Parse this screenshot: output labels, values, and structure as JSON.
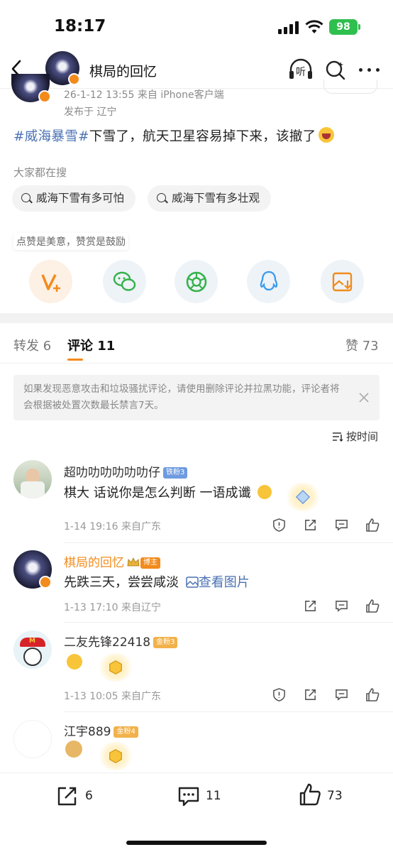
{
  "status_bar": {
    "time": "18:17",
    "battery": "98"
  },
  "nav": {
    "title": "棋局的回忆",
    "listen_label": "听"
  },
  "post": {
    "date_source": "26-1-12 13:55  来自 iPhone客户端",
    "location": "发布于 辽宁",
    "hashtag": "#威海暴雪#",
    "text": "下雪了，航天卫星容易掉下来，该撤了"
  },
  "search_section": {
    "title": "大家都在搜",
    "chips": [
      "威海下雪有多可怕",
      "威海下雪有多壮观"
    ]
  },
  "share_tip": "点赞是美意，赞赏是鼓励",
  "tabs": {
    "repost": "转发 6",
    "comment": "评论 11",
    "like": "赞 73"
  },
  "notice": "如果发现恶意攻击和垃圾骚扰评论，请使用删除评论并拉黑功能，评论者将会根据被处置次数最长禁言7天。",
  "sort_label": "按时间",
  "comments": [
    {
      "name": "超叻叻叻叻叻叻仔",
      "badge": "铁粉3",
      "text": "棋大 话说你是怎么判断 一语成谶",
      "meta": "1-14 19:16  来自广东"
    },
    {
      "name": "棋局的回忆",
      "badge": "博主",
      "text": "先跌三天，尝尝咸淡",
      "link": "查看图片",
      "meta": "1-13 17:10  来自辽宁"
    },
    {
      "name": "二友先锋22418",
      "badge": "金粉3",
      "text": "",
      "meta": "1-13 10:05  来自广东"
    },
    {
      "name": "江宇889",
      "badge": "金粉4",
      "text": "",
      "meta": ""
    }
  ],
  "bottom_bar": {
    "repost_count": "6",
    "comment_count": "11",
    "like_count": "73"
  },
  "colors": {
    "accent": "#f28b1c",
    "link": "#4a71b3",
    "battery": "#2fbf4f"
  }
}
